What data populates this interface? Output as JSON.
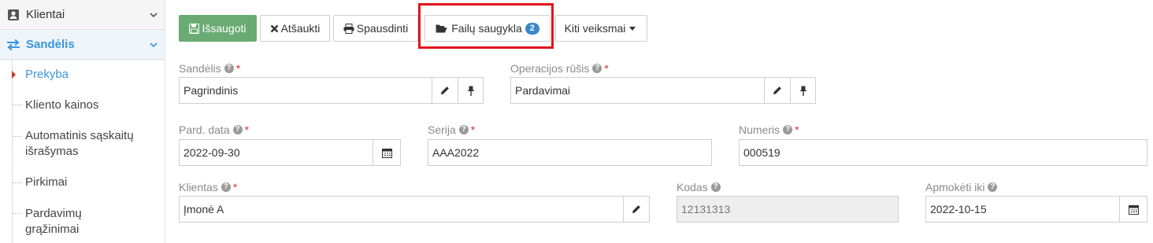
{
  "sidebar": {
    "sections": [
      {
        "label": "Klientai"
      },
      {
        "label": "Sandėlis"
      }
    ],
    "items": [
      {
        "label": "Prekyba"
      },
      {
        "label": "Kliento kainos"
      },
      {
        "label": "Automatinis sąskaitų išrašymas"
      },
      {
        "label": "Pirkimai"
      },
      {
        "label": "Pardavimų grąžinimai"
      }
    ]
  },
  "toolbar": {
    "save_label": "Išsaugoti",
    "cancel_label": "Atšaukti",
    "print_label": "Spausdinti",
    "files_label": "Failų saugykla",
    "files_count": "2",
    "more_label": "Kiti veiksmai"
  },
  "form": {
    "warehouse": {
      "label": "Sandėlis",
      "value": "Pagrindinis"
    },
    "operation_type": {
      "label": "Operacijos rūšis",
      "value": "Pardavimai"
    },
    "sale_date": {
      "label": "Pard. data",
      "value": "2022-09-30"
    },
    "series": {
      "label": "Serija",
      "value": "AAA2022"
    },
    "number": {
      "label": "Numeris",
      "value": "000519"
    },
    "client": {
      "label": "Klientas",
      "value": "Įmonė A"
    },
    "code": {
      "label": "Kodas",
      "value": "12131313"
    },
    "pay_until": {
      "label": "Apmokėti iki",
      "value": "2022-10-15"
    },
    "required_mark": "*",
    "help_mark": "?"
  },
  "colors": {
    "accent": "#3a96dd",
    "save_button": "#6aab73",
    "highlight": "#e3141d",
    "required": "#d9302c"
  }
}
